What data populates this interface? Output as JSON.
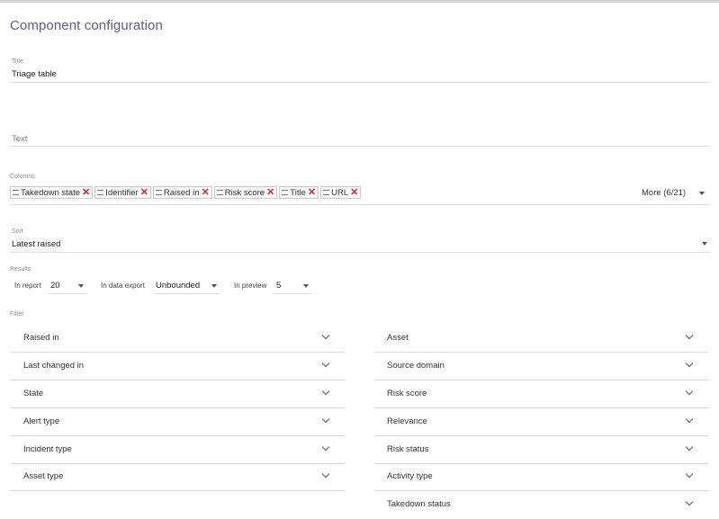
{
  "page": {
    "heading": "Component configuration"
  },
  "title_field": {
    "label": "Title",
    "value": "Triage table"
  },
  "text_field": {
    "placeholder": "Text"
  },
  "columns": {
    "label": "Columns",
    "chips": [
      "Takedown state",
      "Identifier",
      "Raised in",
      "Risk score",
      "Title",
      "URL"
    ],
    "more": "More (6/21)"
  },
  "sort": {
    "label": "Sort",
    "value": "Latest raised"
  },
  "results": {
    "label": "Results",
    "in_report": {
      "label": "In report",
      "value": "20"
    },
    "in_data_export": {
      "label": "In data export",
      "value": "Unbounded"
    },
    "in_preview": {
      "label": "In preview",
      "value": "5"
    }
  },
  "filter": {
    "label": "Filter",
    "left": [
      "Raised in",
      "Last changed in",
      "State",
      "Alert type",
      "Incident type",
      "Asset type"
    ],
    "right": [
      "Asset",
      "Source domain",
      "Risk score",
      "Relevance",
      "Risk status",
      "Activity type",
      "Takedown status"
    ]
  },
  "colors": {
    "heading": "#5c5c8f",
    "remove": "#e0242b",
    "underline": "#dedede"
  },
  "icons": {
    "remove": "close-icon",
    "drag": "drag-handle-icon",
    "dropdown": "chevron-down-icon"
  }
}
